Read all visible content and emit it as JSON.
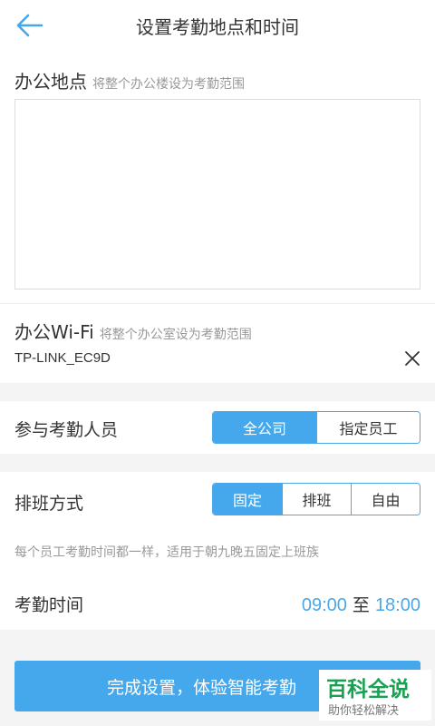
{
  "header": {
    "title": "设置考勤地点和时间"
  },
  "location": {
    "title": "办公地点",
    "hint": "将整个办公楼设为考勤范围"
  },
  "wifi": {
    "title": "办公Wi-Fi",
    "hint": "将整个办公室设为考勤范围",
    "network": "TP-LINK_EC9D"
  },
  "participants": {
    "title": "参与考勤人员",
    "options": [
      "全公司",
      "指定员工"
    ],
    "selected": "全公司"
  },
  "schedule": {
    "title": "排班方式",
    "options": [
      "固定",
      "排班",
      "自由"
    ],
    "selected": "固定",
    "description": "每个员工考勤时间都一样，适用于朝九晚五固定上班族"
  },
  "attendance_time": {
    "title": "考勤时间",
    "start": "09:00",
    "separator": "至",
    "end": "18:00"
  },
  "finish_button": {
    "label": "完成设置，体验智能考勤"
  },
  "watermark": {
    "title": "百科全说",
    "subtitle": "助你轻松解决"
  },
  "colors": {
    "accent": "#45a8ec",
    "background_gap": "#f4f4f4",
    "watermark_green": "#19a052"
  },
  "icons": {
    "back": "arrow-left-icon",
    "clear": "close-icon"
  }
}
